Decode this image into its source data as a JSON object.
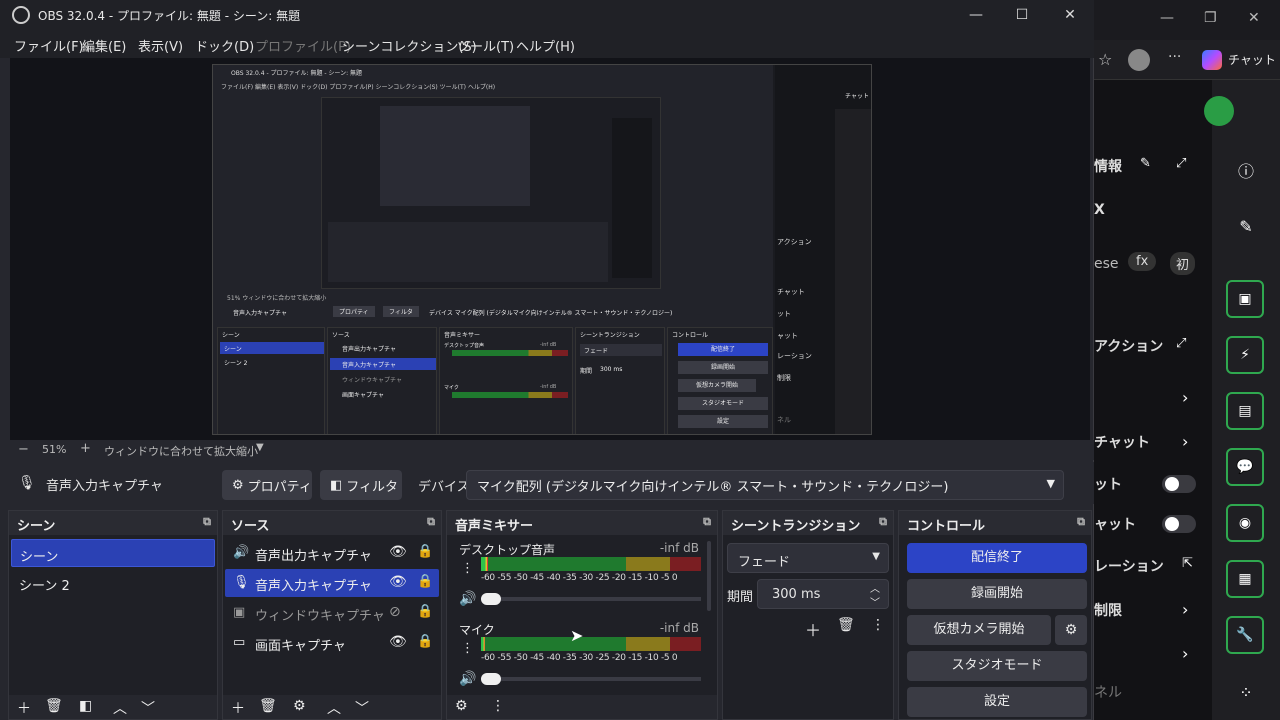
{
  "window": {
    "title": "OBS 32.0.4 - プロファイル: 無題 - シーン: 無題",
    "minimize": "—",
    "maximize": "☐",
    "close": "✕"
  },
  "menu": [
    {
      "label": "ファイル(F)",
      "enabled": true
    },
    {
      "label": "編集(E)",
      "enabled": true
    },
    {
      "label": "表示(V)",
      "enabled": true
    },
    {
      "label": "ドック(D)",
      "enabled": true
    },
    {
      "label": "プロファイル(P)",
      "enabled": false
    },
    {
      "label": "シーンコレクション(S)",
      "enabled": true
    },
    {
      "label": "ツール(T)",
      "enabled": true
    },
    {
      "label": "ヘルプ(H)",
      "enabled": true
    }
  ],
  "zoom": {
    "minus": "−",
    "value": "51%",
    "plus": "+",
    "fit_label": "ウィンドウに合わせて拡大縮小"
  },
  "source_bar": {
    "source_name": "音声入力キャプチャ",
    "properties": "プロパティ",
    "filters": "フィルタ",
    "device_label": "デバイス",
    "device_value": "マイク配列 (デジタルマイク向けインテル® スマート・サウンド・テクノロジー)"
  },
  "scenes": {
    "title": "シーン",
    "items": [
      {
        "label": "シーン",
        "selected": true
      },
      {
        "label": "シーン 2",
        "selected": false
      }
    ]
  },
  "sources": {
    "title": "ソース",
    "items": [
      {
        "label": "音声出力キャプチャ",
        "icon": "speaker-icon",
        "visible": true
      },
      {
        "label": "音声入力キャプチャ",
        "icon": "mic-icon",
        "visible": true
      },
      {
        "label": "ウィンドウキャプチャ",
        "icon": "window-icon",
        "visible": false
      },
      {
        "label": "画面キャプチャ",
        "icon": "monitor-icon",
        "visible": true
      }
    ]
  },
  "mixer": {
    "title": "音声ミキサー",
    "channels": [
      {
        "name": "デスクトップ音声",
        "db": "-inf dB",
        "level": 0.03
      },
      {
        "name": "マイク",
        "db": "-inf dB",
        "level": 0.02
      }
    ],
    "scale": "-60 -55 -50 -45 -40 -35 -30 -25 -20 -15 -10 -5  0"
  },
  "transitions": {
    "title": "シーントランジション",
    "transition": "フェード",
    "duration_label": "期間",
    "duration_value": "300 ms"
  },
  "controls": {
    "title": "コントロール",
    "buttons": [
      "配信終了",
      "録画開始",
      "仮想カメラ開始",
      "スタジオモード",
      "設定"
    ]
  },
  "browser": {
    "chat": "チャット",
    "panel_labels": [
      "情報",
      "X",
      "ese",
      "fx",
      "初",
      "アクション",
      "チャット",
      "ット",
      "ャット",
      "レーション",
      "制限",
      "ネル"
    ]
  },
  "nested": {
    "title": "OBS 32.0.4 - プロファイル: 無題 - シーン: 無題",
    "menu": "ファイル(F)  編集(E)  表示(V)  ドック(D)  プロファイル(P)  シーンコレクション(S)  ツール(T)  ヘルプ(H)",
    "zoom": "51%   ウィンドウに合わせて拡大縮小",
    "source_name": "音声入力キャプチャ",
    "properties": "プロパティ",
    "filters": "フィルタ",
    "device": "デバイス   マイク配列 (デジタルマイク向けインテル® スマート・サウンド・テクノロジー)",
    "scenes_title": "シーン",
    "scene1": "シーン",
    "scene2": "シーン 2",
    "sources_title": "ソース",
    "src1": "音声出力キャプチャ",
    "src2": "音声入力キャプチャ",
    "src3": "ウィンドウキャプチャ",
    "src4": "画面キャプチャ",
    "mixer_title": "音声ミキサー",
    "mix1": "デスクトップ音声",
    "mix2": "マイク",
    "db": "-inf dB",
    "trans_title": "シーントランジション",
    "fade": "フェード",
    "dur_label": "期間",
    "dur_value": "300 ms",
    "ctrl_title": "コントロール",
    "b1": "配信終了",
    "b2": "録画開始",
    "b3": "仮想カメラ開始",
    "b4": "スタジオモード",
    "b5": "設定",
    "chat": "チャット",
    "side1": "アクション",
    "side2": "チャット",
    "side3": "ット",
    "side4": "ャット",
    "side5": "レーション",
    "side6": "制限",
    "side7": "ネル"
  },
  "colors": {
    "accent": "#2c44c6",
    "selected": "#2b41b4",
    "rail_border": "#2fa84f"
  }
}
